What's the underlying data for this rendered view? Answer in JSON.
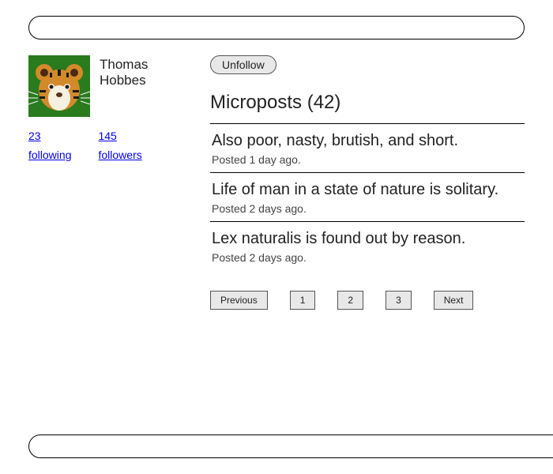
{
  "user": {
    "name": "Thomas Hobbes",
    "avatar_icon": "tiger"
  },
  "stats": {
    "following_count": "23",
    "following_label": "following",
    "followers_count": "145",
    "followers_label": "followers"
  },
  "follow_button": {
    "label": "Unfollow"
  },
  "microposts": {
    "heading": "Microposts (42)",
    "items": [
      {
        "content": "Also poor, nasty, brutish, and short.",
        "meta": "Posted 1 day ago."
      },
      {
        "content": "Life of man in a state of nature is solitary.",
        "meta": "Posted 2 days ago."
      },
      {
        "content": "Lex naturalis is found out by reason.",
        "meta": "Posted 2 days ago."
      }
    ]
  },
  "pagination": {
    "previous": "Previous",
    "pages": [
      "1",
      "2",
      "3"
    ],
    "next": "Next"
  }
}
